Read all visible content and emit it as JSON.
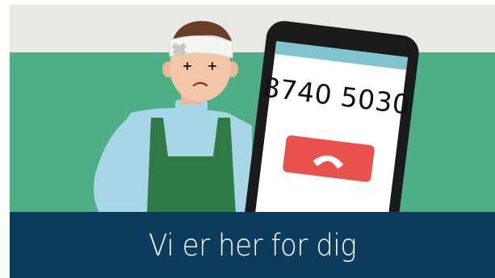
{
  "banner": {
    "phone_number": "8740 5030",
    "tagline": "Vi er her for dig"
  },
  "icons": {
    "person": "injured-person-illustration",
    "phone": "mobile-phone-icon",
    "hangup": "phone-hangup-icon",
    "bandage": "bandage-icon"
  },
  "colors": {
    "top_strip": "#e8e8e4",
    "green_band": "#4eaf86",
    "footer_bar": "#0c3d5e",
    "phone_body": "#1a1a1a",
    "screen": "#ffffff",
    "screen_header": "#7fc4cf",
    "hangup_button": "#e8524a",
    "shirt": "#a7d6e6",
    "apron": "#2f7a45"
  }
}
